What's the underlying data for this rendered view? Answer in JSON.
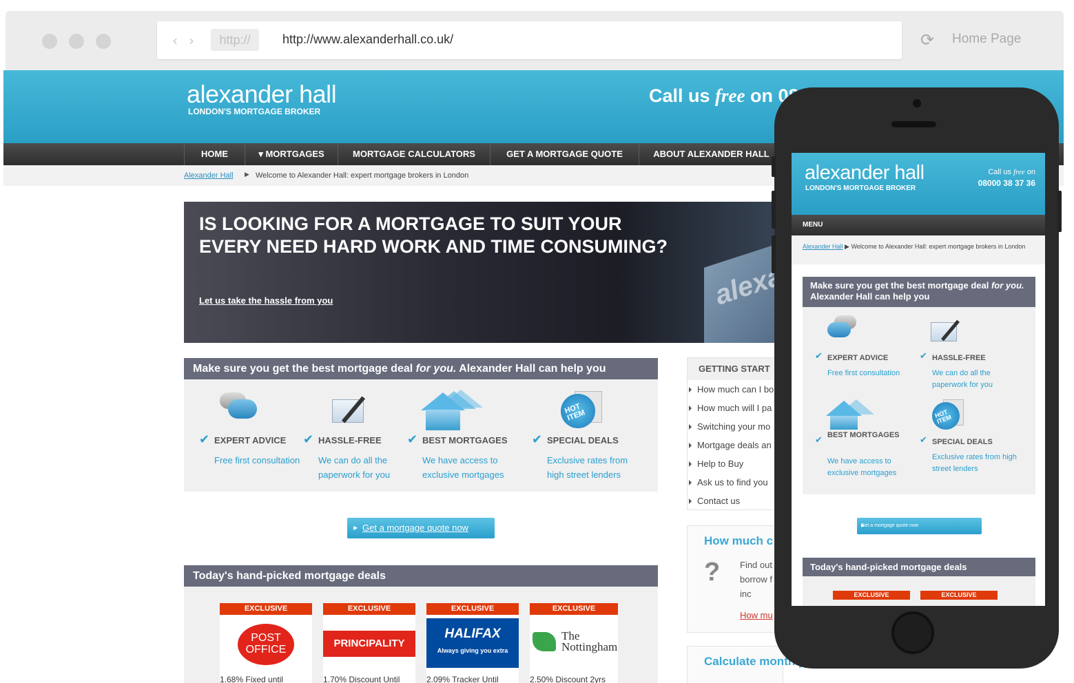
{
  "browser": {
    "protocol": "http://",
    "url": "http://www.alexanderhall.co.uk/",
    "home_label": "Home Page",
    "back_glyph": "‹",
    "forward_glyph": "›",
    "reload_glyph": "⟳"
  },
  "site": {
    "logo": "alexander hall",
    "tagline": "LONDON'S MORTGAGE BROKER",
    "call_prefix": "Call us ",
    "call_free": "free",
    "call_on": " on 08",
    "nav": [
      "HOME",
      "▾ MORTGAGES",
      "MORTGAGE CALCULATORS",
      "GET A MORTGAGE QUOTE",
      "ABOUT ALEXANDER HALL"
    ],
    "breadcrumb": {
      "link": "Alexander Hall",
      "sep": "▶",
      "current": "Welcome to Alexander Hall: expert mortgage brokers in London"
    },
    "hero": {
      "headline": "IS LOOKING FOR A MORTGAGE TO SUIT YOUR EVERY NEED HARD WORK AND TIME CONSUMING?",
      "link": "Let us take the hassle from you",
      "sign_text": "alexa"
    },
    "help": {
      "title_a": "Make sure you get the best mortgage deal ",
      "title_em": "for you.",
      "title_b": " Alexander Hall can help you",
      "features": [
        {
          "title": "EXPERT ADVICE",
          "desc": "Free first consultation",
          "icon": "speech-bubbles-icon"
        },
        {
          "title": "HASSLE-FREE",
          "desc": "We can do all the paperwork for you",
          "icon": "envelope-pen-icon"
        },
        {
          "title": "BEST MORTGAGES",
          "desc": "We have access to exclusive mortgages",
          "icon": "houses-icon"
        },
        {
          "title": "SPECIAL DEALS",
          "desc": "Exclusive rates from high street lenders",
          "icon": "hot-item-badge-icon"
        }
      ],
      "check_glyph": "✔",
      "hot_item": "HOT ITEM"
    },
    "quote_button": "Get a mortgage quote now",
    "quote_arrow": "▶",
    "deals": {
      "title": "Today's hand-picked mortgage deals",
      "items": [
        {
          "badge": "EXCLUSIVE",
          "lender": "POST OFFICE",
          "rate": "1.68% Fixed until"
        },
        {
          "badge": "EXCLUSIVE",
          "lender": "PRINCIPALITY",
          "rate": "1.70% Discount Until"
        },
        {
          "badge": "EXCLUSIVE",
          "lender": "HALIFAX",
          "slogan": "Always giving you extra",
          "rate": "2.09% Tracker Until"
        },
        {
          "badge": "EXCLUSIVE",
          "lender": "The Nottingham",
          "rate": "2.50% Discount 2yrs"
        }
      ]
    },
    "sidebar": {
      "title": "GETTING START",
      "items": [
        "How much can I bo",
        "How much will I pa",
        "Switching your mo",
        "Mortgage deals an",
        "Help to Buy",
        "Ask us to find you",
        "Contact us"
      ]
    },
    "how_much": {
      "title": "How much c",
      "icon": "?",
      "text": "Find out borrow f your inc",
      "link": "How mu"
    },
    "calc": {
      "title": "Calculate monthly"
    }
  },
  "mobile": {
    "logo": "alexander hall",
    "tagline": "LONDON'S MORTGAGE BROKER",
    "call_prefix": "Call us ",
    "call_free": "free",
    "call_on": " on",
    "phone": "08000 38 37 36",
    "menu": "MENU",
    "breadcrumb_link": "Alexander Hall",
    "breadcrumb_sep": " ▶ ",
    "breadcrumb_current": "Welcome to Alexander Hall: expert mortgage brokers in London",
    "help_title_a": "Make sure you get the best mortgage deal ",
    "help_title_em": "for you.",
    "help_title_b": " Alexander Hall can help you",
    "features": [
      {
        "title": "EXPERT ADVICE",
        "desc": "Free first consultation"
      },
      {
        "title": "HASSLE-FREE",
        "desc": "We can do all the paperwork for you"
      },
      {
        "title": "BEST MORTGAGES",
        "desc": "We have access to exclusive mortgages"
      },
      {
        "title": "SPECIAL DEALS",
        "desc": "Exclusive rates from high street lenders"
      }
    ],
    "quote_button": "Get a mortgage quote now",
    "deals_title": "Today's hand-picked mortgage deals",
    "exclusive": "EXCLUSIVE"
  },
  "colors": {
    "brand_blue": "#2a9fc6",
    "nav_dark": "#3a3a3a",
    "panel_grey": "#676b7c",
    "link_blue": "#2a9fd0",
    "exclusive_red": "#e03a0b"
  }
}
